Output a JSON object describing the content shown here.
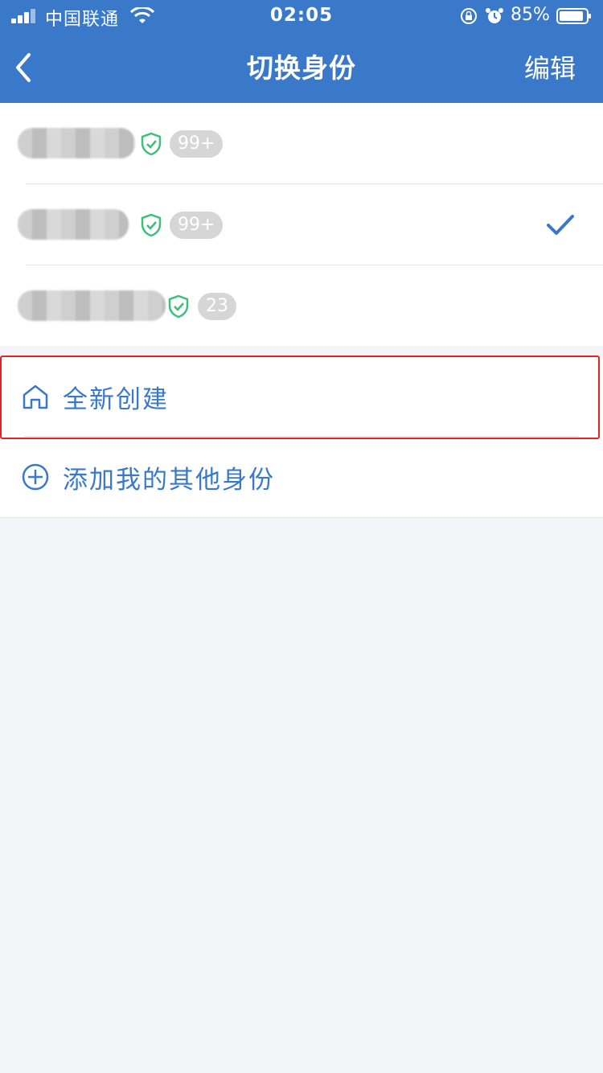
{
  "status_bar": {
    "carrier": "中国联通",
    "time": "02:05",
    "battery": "85%"
  },
  "nav": {
    "title": "切换身份",
    "edit_label": "编辑"
  },
  "identities": [
    {
      "badge": "99+",
      "selected": false
    },
    {
      "badge": "99+",
      "selected": true
    },
    {
      "badge": "23",
      "selected": false
    }
  ],
  "actions": {
    "create_new": "全新创建",
    "add_other": "添加我的其他身份"
  },
  "colors": {
    "brand": "#3a78c9",
    "shield": "#3bbf7a",
    "highlight": "#e02525"
  }
}
